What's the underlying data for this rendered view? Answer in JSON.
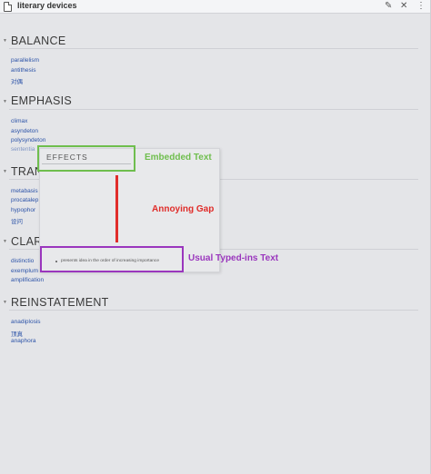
{
  "window": {
    "title": "literary devices",
    "edit_icon": "pencil-icon",
    "close_label": "✕",
    "more_label": "⋮"
  },
  "sections": [
    {
      "heading": "BALANCE",
      "items": [
        "parallelism",
        "antithesis",
        "对偶"
      ]
    },
    {
      "heading": "EMPHASIS",
      "items": [
        "climax",
        "asyndeton",
        "polysyndeton",
        "sententia"
      ]
    },
    {
      "heading": "TRAN",
      "items": [
        "metabasis",
        "procatalep",
        "hypophor",
        "设问"
      ]
    },
    {
      "heading": "CLAR",
      "items": [
        "distinctio",
        "exemplum",
        "amplification"
      ]
    },
    {
      "heading": "REINSTATEMENT",
      "items": [
        "anadiplosis",
        "顶真",
        "anaphora"
      ]
    }
  ],
  "popup": {
    "heading": "EFFECTS",
    "bullet_text": "presents idea in the order of increasing importance"
  },
  "annotations": {
    "embedded": "Embedded Text",
    "gap": "Annoying Gap",
    "typed": "Usual Typed-ins Text"
  },
  "colors": {
    "link": "#2c53a8",
    "annotation_green": "#6fbe4e",
    "annotation_red": "#e02d2a",
    "annotation_purple": "#9a36bd"
  }
}
